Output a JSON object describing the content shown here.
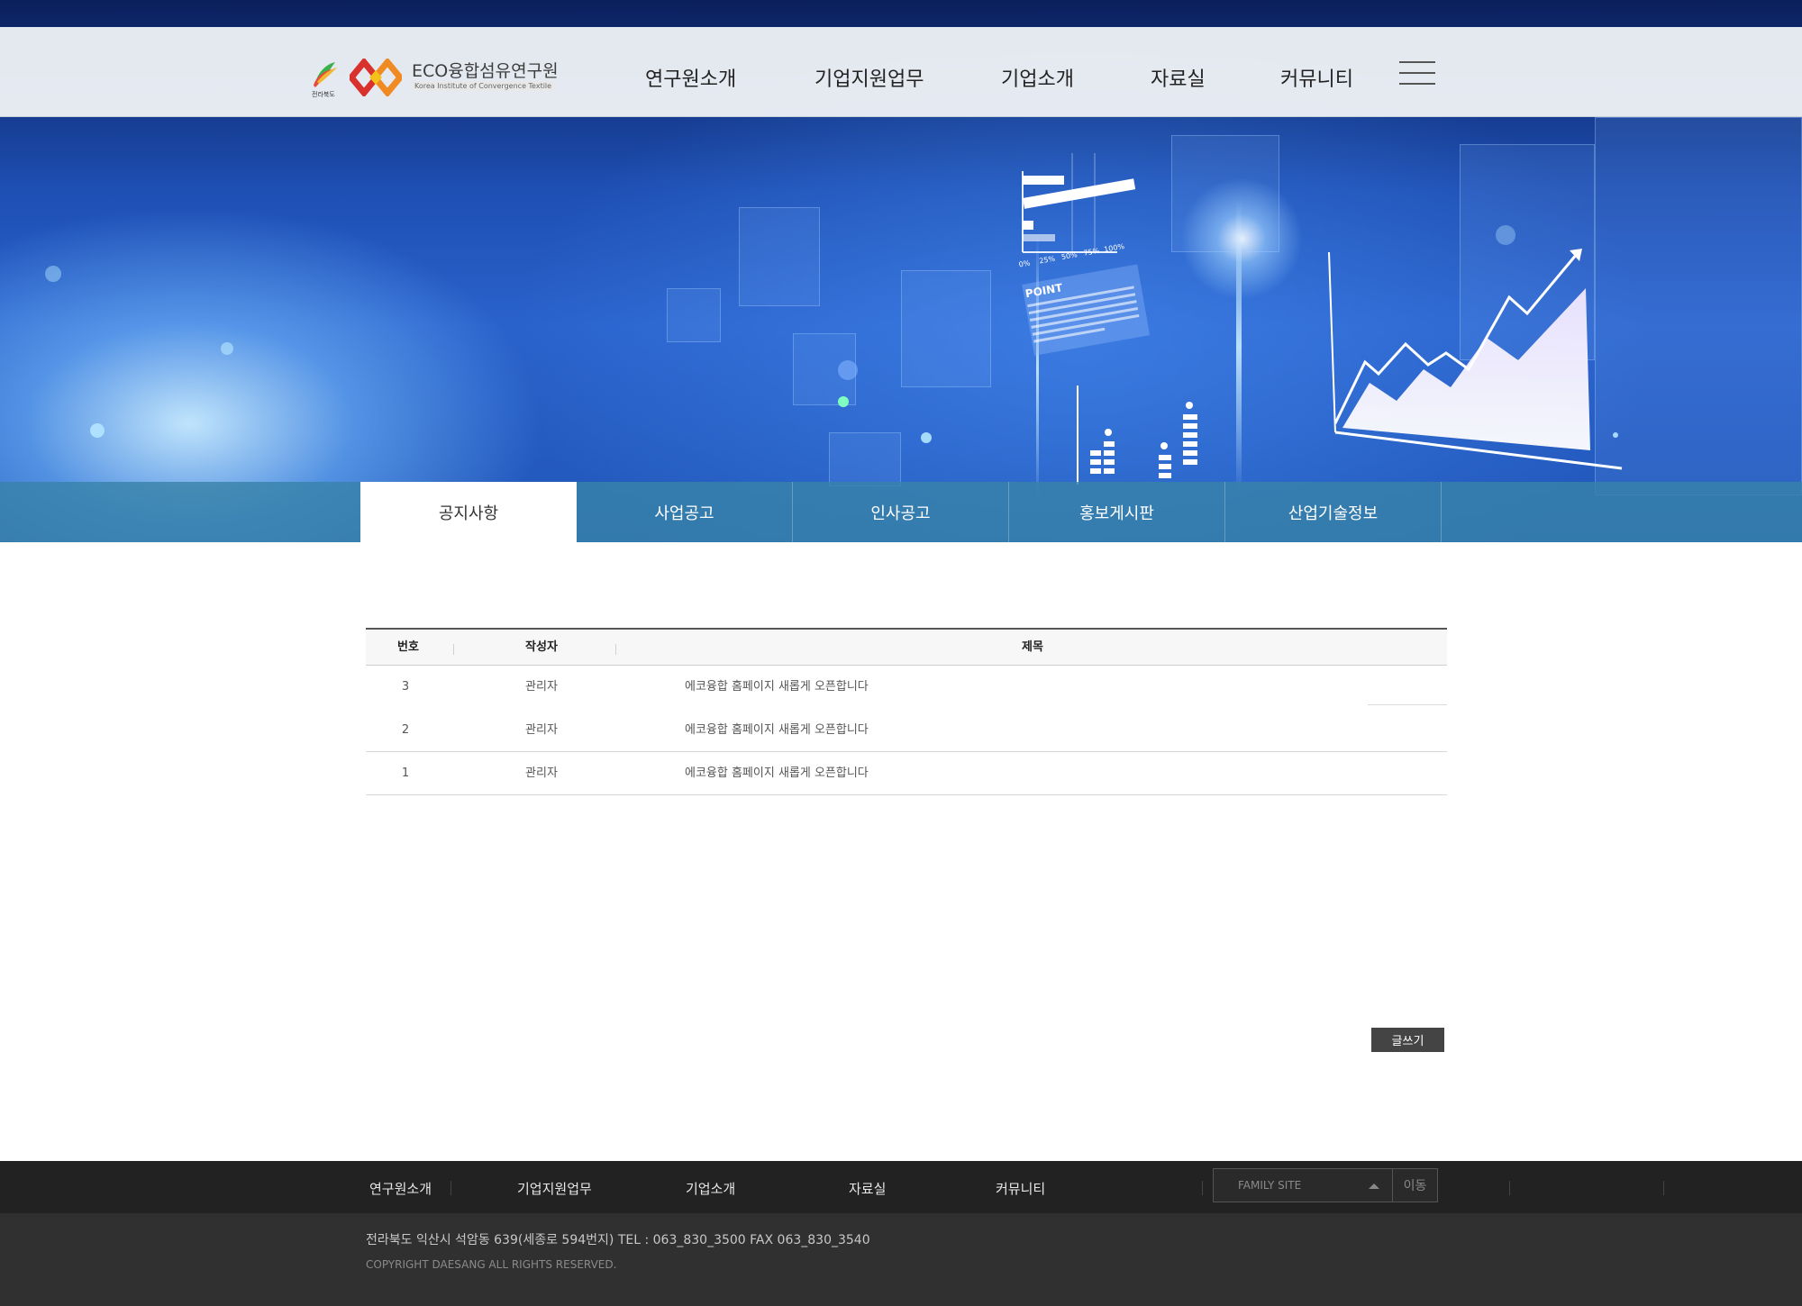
{
  "header": {
    "logo_region": "전라북도",
    "logo_title": "ECO융합섬유연구원",
    "logo_subtitle": "Korea Institute of Convergence Textile",
    "menu": [
      "연구원소개",
      "기업지원업무",
      "기업소개",
      "자료실",
      "커뮤니티"
    ],
    "menu_icon": "hamburger-menu-icon"
  },
  "hero": {
    "graphic_text": {
      "chart_ticks": [
        "0%",
        "25%",
        "50%",
        "75%",
        "100%"
      ],
      "point_label": "POINT"
    }
  },
  "subtabs": {
    "items": [
      "공지사항",
      "사업공고",
      "인사공고",
      "홍보게시판",
      "산업기술정보"
    ],
    "active": "공지사항"
  },
  "board": {
    "headers": {
      "number": "번호",
      "writer": "작성자",
      "title": "제목"
    },
    "rows": [
      {
        "number": "3",
        "writer": "관리자",
        "title": "에코융합 홈페이지 새롭게 오픈합니다"
      },
      {
        "number": "2",
        "writer": "관리자",
        "title": "에코융합 홈페이지 새롭게 오픈합니다"
      },
      {
        "number": "1",
        "writer": "관리자",
        "title": "에코융합 홈페이지 새롭게 오픈합니다"
      }
    ],
    "write_button": "글쓰기"
  },
  "footer": {
    "nav": [
      "연구원소개",
      "기업지원업무",
      "기업소개",
      "자료실",
      "커뮤니티"
    ],
    "family_site": "FAMILY SITE",
    "go_button": "이동",
    "address": "전라북도 익산시 석암동 639(세종로 594번지)   TEL : 063_830_3500    FAX   063_830_3540",
    "copyright": "COPYRIGHT DAESANG ALL RIGHTS RESERVED."
  },
  "colors": {
    "accent_tab_bar": "#3882aa",
    "footer_nav_bg": "#222222",
    "footer_info_bg": "#303030",
    "write_button_bg": "#444444"
  }
}
